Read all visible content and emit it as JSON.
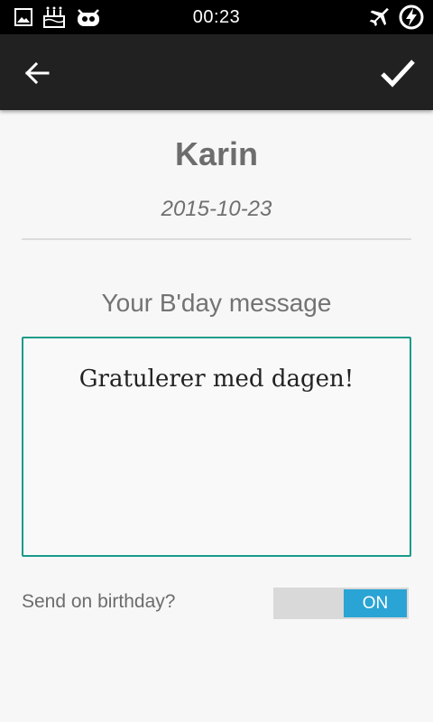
{
  "status_bar": {
    "time": "00:23",
    "icons_left": [
      "image-icon",
      "birthday-cake-icon",
      "cyanogen-icon"
    ],
    "icons_right": [
      "airplane-mode-icon",
      "battery-charging-icon"
    ]
  },
  "app_bar": {
    "back_icon": "arrow-back-icon",
    "done_icon": "check-icon",
    "background": "#212121"
  },
  "contact": {
    "name": "Karin",
    "date": "2015-10-23"
  },
  "message": {
    "label": "Your B'day message",
    "text": "Gratulerer med dagen!",
    "border_color": "#1a9a8a"
  },
  "send_option": {
    "label": "Send on birthday?",
    "toggle_state": "ON",
    "toggle_color": "#2aa4d4"
  }
}
